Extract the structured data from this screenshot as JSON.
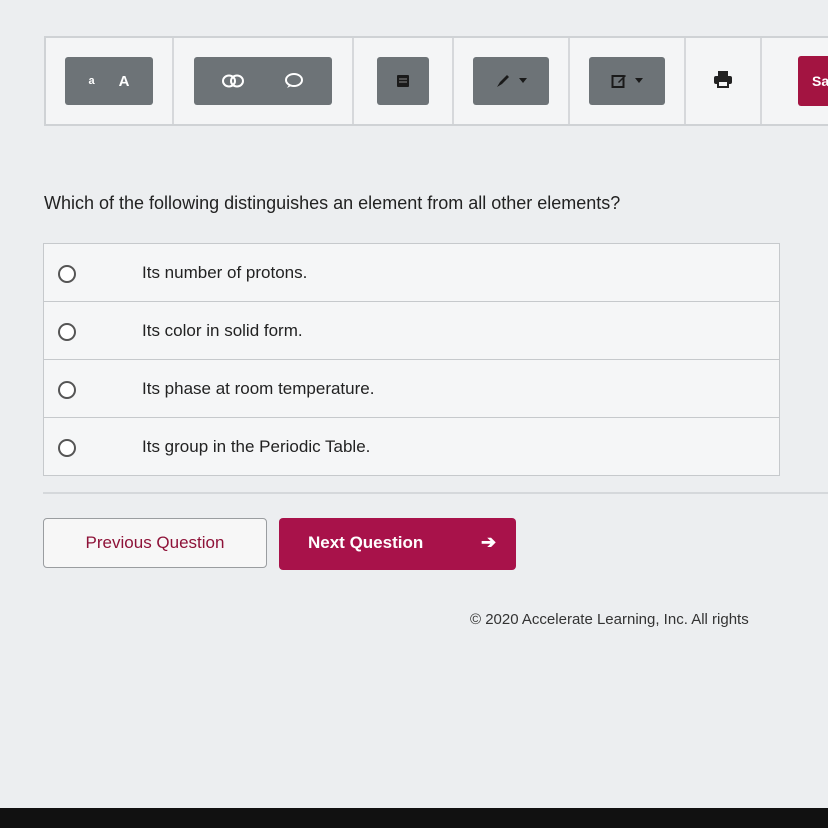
{
  "toolbar": {
    "font_small_label": "a",
    "font_large_label": "A",
    "save_label": "Sa",
    "icons": [
      "text-size-small",
      "text-size-large",
      "eliminate-icon",
      "comment-icon",
      "notes-icon",
      "highlighter-icon",
      "edit-icon",
      "print-icon"
    ]
  },
  "question": {
    "text": "Which of the following distinguishes an element from all other elements?",
    "options": [
      "Its number of protons.",
      "Its color in solid form.",
      "Its phase at room temperature.",
      "Its group in the Periodic Table."
    ]
  },
  "navigation": {
    "previous_label": "Previous Question",
    "next_label": "Next Question",
    "next_arrow": "➔"
  },
  "footer": {
    "copyright": "© 2020 Accelerate Learning, Inc. All rights"
  },
  "colors": {
    "accent": "#a8124a",
    "toolbar_button": "#6d7377",
    "background": "#eceef0"
  }
}
